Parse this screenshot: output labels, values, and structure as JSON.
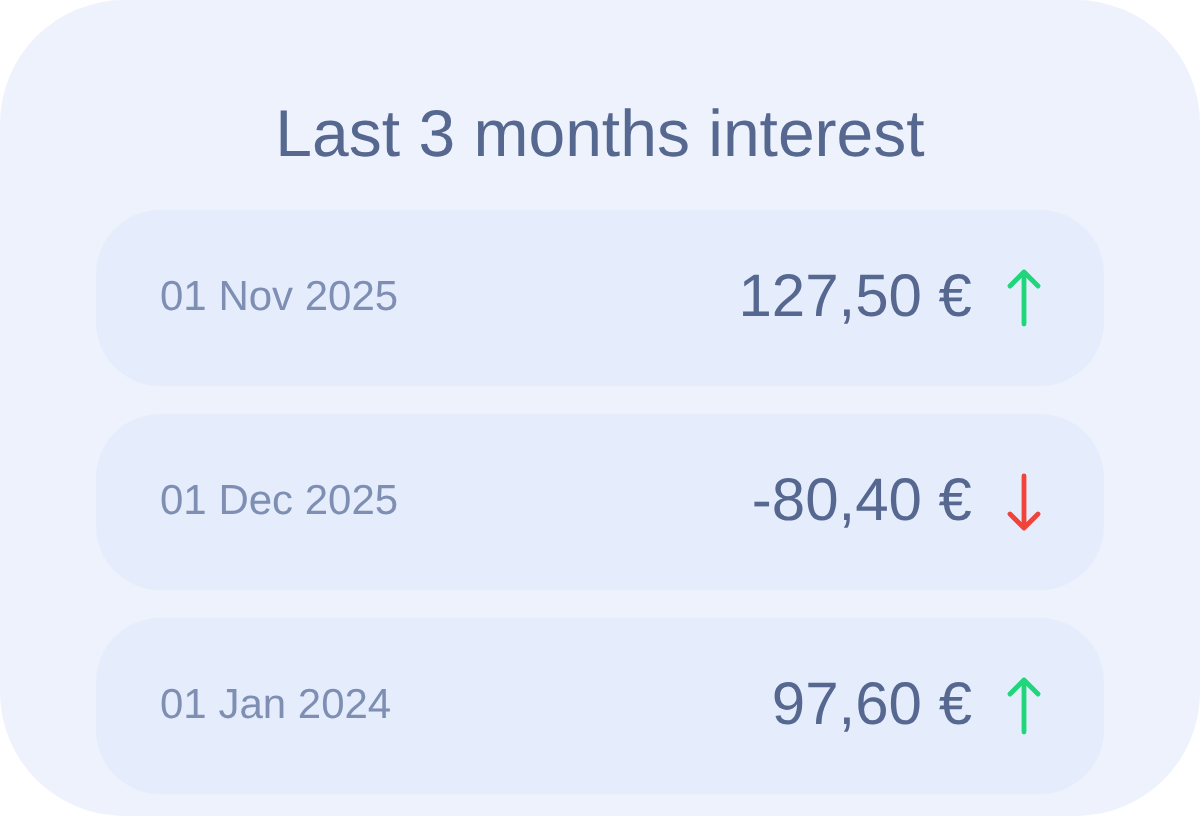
{
  "title": "Last 3 months interest",
  "entries": [
    {
      "date": "01 Nov 2025",
      "amount": "127,50 €",
      "kind": "up"
    },
    {
      "date": "01 Dec 2025",
      "amount": "-80,40 €",
      "kind": "down"
    },
    {
      "date": "01 Jan 2024",
      "amount": "97,60 €",
      "kind": "up"
    }
  ]
}
